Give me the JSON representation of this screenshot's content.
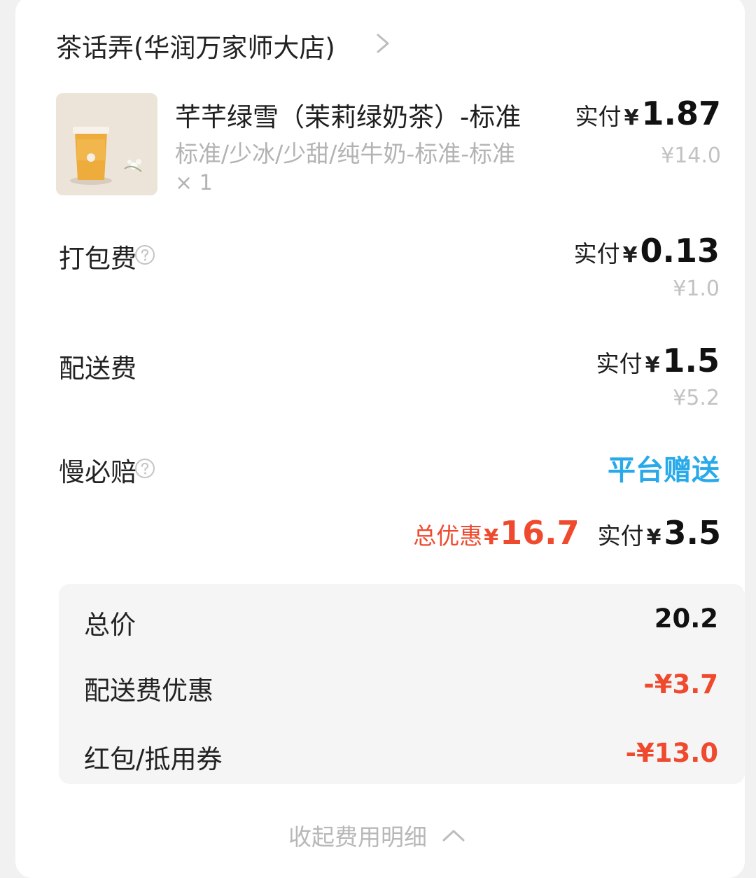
{
  "store": {
    "name": "茶话弄(华润万家师大店)",
    "chevron_icon": "chevron-right-icon"
  },
  "product": {
    "name": "芊芊绿雪（茉莉绿奶茶）-标准",
    "spec": "标准/少冰/少甜/纯牛奶-标准-标准",
    "quantity": "× 1",
    "pay_label": "实付",
    "yen": "¥",
    "pay_amount": "1.87",
    "original_price": "¥14.0"
  },
  "packing_fee": {
    "label": "打包费",
    "pay_label": "实付",
    "yen": "¥",
    "pay_amount": "0.13",
    "original_price": "¥1.0",
    "help_icon": "question-circle-icon"
  },
  "delivery_fee": {
    "label": "配送费",
    "pay_label": "实付",
    "yen": "¥",
    "pay_amount": "1.5",
    "original_price": "¥5.2"
  },
  "late_compensation": {
    "label": "慢必赔",
    "value": "平台赠送",
    "help_icon": "question-circle-icon"
  },
  "summary": {
    "discount_label": "总优惠",
    "discount_yen": "¥",
    "discount_amount": "16.7",
    "pay_label": "实付",
    "pay_yen": "¥",
    "pay_amount": "3.5"
  },
  "details": [
    {
      "label": "总价",
      "value": "20.2",
      "negative": false
    },
    {
      "label": "配送费优惠",
      "value": "-¥3.7",
      "negative": true
    },
    {
      "label": "红包/抵用券",
      "value": "-¥13.0",
      "negative": true
    }
  ],
  "collapse": {
    "label": "收起费用明细",
    "icon": "chevron-up-icon"
  },
  "colors": {
    "accent_red": "#ef4a2e",
    "accent_blue": "#27a9ea",
    "background": "#f1f1f1",
    "card": "#ffffff"
  }
}
